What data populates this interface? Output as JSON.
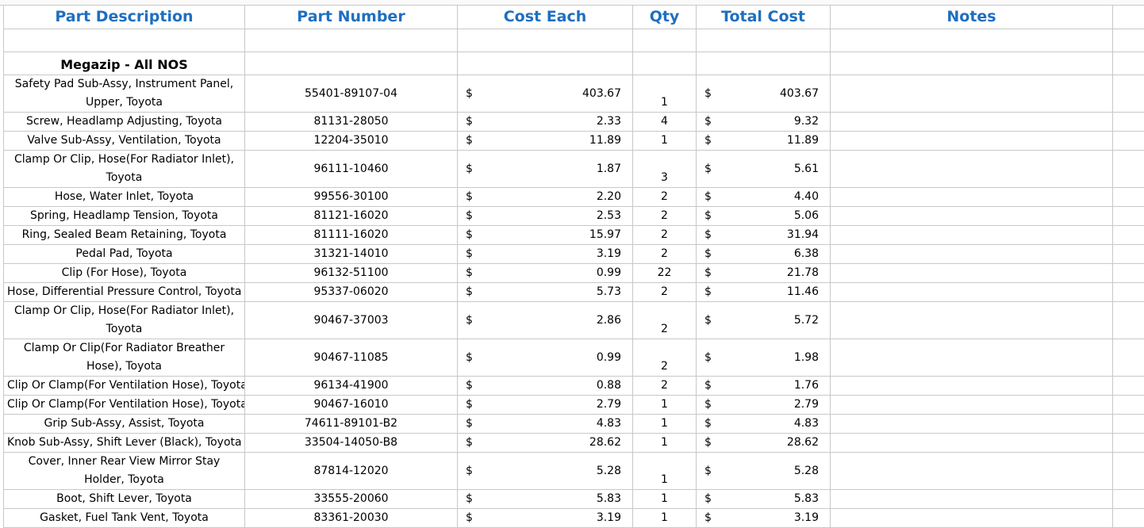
{
  "headers": {
    "desc": "Part Description",
    "num": "Part Number",
    "cost": "Cost Each",
    "qty": "Qty",
    "total": "Total Cost",
    "notes": "Notes"
  },
  "section_title": "Megazip - All NOS",
  "currency": "$",
  "rows": [
    {
      "desc": "Safety Pad Sub-Assy, Instrument Panel, Upper, Toyota",
      "num": "55401-89107-04",
      "cost": "403.67",
      "qty": "1",
      "total": "403.67",
      "tall": true
    },
    {
      "desc": "Screw, Headlamp Adjusting, Toyota",
      "num": "81131-28050",
      "cost": "2.33",
      "qty": "4",
      "total": "9.32"
    },
    {
      "desc": "Valve Sub-Assy, Ventilation, Toyota",
      "num": "12204-35010",
      "cost": "11.89",
      "qty": "1",
      "total": "11.89"
    },
    {
      "desc": "Clamp Or Clip, Hose(For Radiator Inlet), Toyota",
      "num": "96111-10460",
      "cost": "1.87",
      "qty": "3",
      "total": "5.61",
      "tall": true
    },
    {
      "desc": "Hose, Water Inlet, Toyota",
      "num": "99556-30100",
      "cost": "2.20",
      "qty": "2",
      "total": "4.40"
    },
    {
      "desc": "Spring, Headlamp Tension, Toyota",
      "num": "81121-16020",
      "cost": "2.53",
      "qty": "2",
      "total": "5.06"
    },
    {
      "desc": "Ring, Sealed Beam Retaining, Toyota",
      "num": "81111-16020",
      "cost": "15.97",
      "qty": "2",
      "total": "31.94"
    },
    {
      "desc": "Pedal Pad, Toyota",
      "num": "31321-14010",
      "cost": "3.19",
      "qty": "2",
      "total": "6.38"
    },
    {
      "desc": "Clip (For Hose), Toyota",
      "num": "96132-51100",
      "cost": "0.99",
      "qty": "22",
      "total": "21.78"
    },
    {
      "desc": "Hose, Differential Pressure Control, Toyota",
      "num": "95337-06020",
      "cost": "5.73",
      "qty": "2",
      "total": "11.46"
    },
    {
      "desc": "Clamp Or Clip, Hose(For Radiator Inlet), Toyota",
      "num": "90467-37003",
      "cost": "2.86",
      "qty": "2",
      "total": "5.72",
      "tall": true
    },
    {
      "desc": "Clamp Or Clip(For Radiator Breather Hose), Toyota",
      "num": "90467-11085",
      "cost": "0.99",
      "qty": "2",
      "total": "1.98",
      "tall": true
    },
    {
      "desc": "Clip Or Clamp(For Ventilation Hose), Toyota",
      "num": "96134-41900",
      "cost": "0.88",
      "qty": "2",
      "total": "1.76"
    },
    {
      "desc": "Clip Or Clamp(For Ventilation Hose), Toyota",
      "num": "90467-16010",
      "cost": "2.79",
      "qty": "1",
      "total": "2.79"
    },
    {
      "desc": "Grip Sub-Assy, Assist, Toyota",
      "num": "74611-89101-B2",
      "cost": "4.83",
      "qty": "1",
      "total": "4.83"
    },
    {
      "desc": "Knob Sub-Assy, Shift Lever (Black), Toyota",
      "num": "33504-14050-B8",
      "cost": "28.62",
      "qty": "1",
      "total": "28.62"
    },
    {
      "desc": "Cover, Inner Rear View Mirror Stay Holder, Toyota",
      "num": "87814-12020",
      "cost": "5.28",
      "qty": "1",
      "total": "5.28",
      "tall": true
    },
    {
      "desc": "Boot, Shift Lever, Toyota",
      "num": "33555-20060",
      "cost": "5.83",
      "qty": "1",
      "total": "5.83"
    },
    {
      "desc": "Gasket, Fuel Tank Vent, Toyota",
      "num": "83361-20030",
      "cost": "3.19",
      "qty": "1",
      "total": "3.19"
    }
  ]
}
